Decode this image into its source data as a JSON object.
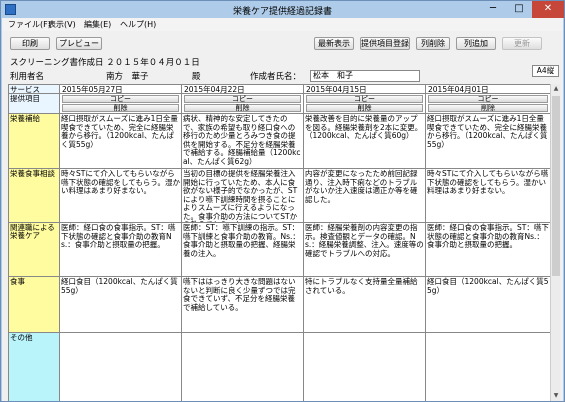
{
  "window": {
    "title": "栄養ケア提供経過記録書",
    "controls": {
      "minimize": "─",
      "maximize": "□",
      "close": "✕"
    }
  },
  "menu": [
    "ファイル(F)",
    "表示(V)",
    "編集(E)",
    "ヘルプ(H)"
  ],
  "toolbar": {
    "print": "印刷",
    "preview": "プレビュー",
    "latest": "最新表示",
    "register_item": "提供項目登録",
    "delete_column": "列削除",
    "add_column": "列追加",
    "update": "更新"
  },
  "info": {
    "screening_date": "スクリーニング書作成日 ２０１５年０４月０１日",
    "user_label": "利用者名",
    "user_name": "南方　華子",
    "honorific": "殿",
    "author_label": "作成者氏名：",
    "author_name": "松本　和子",
    "paper_size": "A4縦"
  },
  "grid": {
    "header_label": "サービス",
    "item_label": "提供項目",
    "copy_label": "コピー",
    "delete_label": "削除",
    "columns": [
      {
        "date": "2015年05月27日"
      },
      {
        "date": "2015年04月22日"
      },
      {
        "date": "2015年04月15日"
      },
      {
        "date": "2015年04月01日"
      }
    ],
    "rows": [
      {
        "label": "栄養補給",
        "cells": [
          "経口摂取がスムーズに進み1日全量喫食できていため、完全に経腸栄養から移行。（1200kcal、たんぱく質55g）",
          "病状、精神的な安定してきたので、家族の希望も取り経口食への移行のため少量とろみつき食の提供を開始する。不足分を経腸栄養で補給する。経腸補給量（1200kcal、たんぱく質62g）",
          "栄養改善を目的に栄養量のアップを図る。経腸栄養剤を2本に変更。（1200kcal、たんぱく質60g）",
          "経口摂取がスムーズに進み1日全量喫食できていため、完全に経腸栄養から移行。（1200kcal、たんぱく質55g）"
        ]
      },
      {
        "label": "栄養食事相談",
        "cells": [
          "時々STにて介入してもらいながら嚥下状態の確認をしてもらう。湿かい料理はあまり好まない。",
          "当初の目標の提供を経腸栄養注入開始に行っていたため、本人に食欲がない様子的でなかったが、STにより嚥下訓練時間を摂ることによりスムーズに行えるようになった。食事介助の方法についてSTから教えてもらった。",
          "内容が変更になったため前回記録通り、注入時下痢などのトラブルがないか注入速度は適正か等を確認した。",
          "時々STにて介入してもらいながら嚥下状態の確認をしてもらう。湿かい料理はあまり好まない。"
        ]
      },
      {
        "label": "関連職による栄養ケア",
        "cells": [
          "医師：経口食の食事指示。ST：嚥下状態の確認と食事介助の教育Ns.：食事介助と摂取量の把握。",
          "医師：ST：嚥下訓練の指示。ST：嚥下訓練と食事介助の教育。Ns.：食事介助と摂取量の把握、経腸栄養の注入。",
          "医師：経腸栄養剤の内容変更の指示。検査値観とデータの確認。Ns.：経腸栄養調整、注入。速度等の確認でトラブルへの対応。",
          "医師：経口食の食事指示。ST：嚥下状態の確認と食事介助の教育Ns.：食事介助と摂取量の把握。"
        ]
      },
      {
        "label": "食事",
        "cells": [
          "経口食目（1200kcal、たんぱく質55g）",
          "嚥下ははっきり大きな問題はないないと判断に良く少量ずつでは完食できていず、不足分を経腸栄養で補給している。",
          "特にトラブルなく支持量全量補給されている。",
          "経口食目（1200kcal、たんぱく質55g）"
        ]
      },
      {
        "label": "その他",
        "cells": [
          "",
          "",
          "",
          ""
        ]
      }
    ]
  }
}
